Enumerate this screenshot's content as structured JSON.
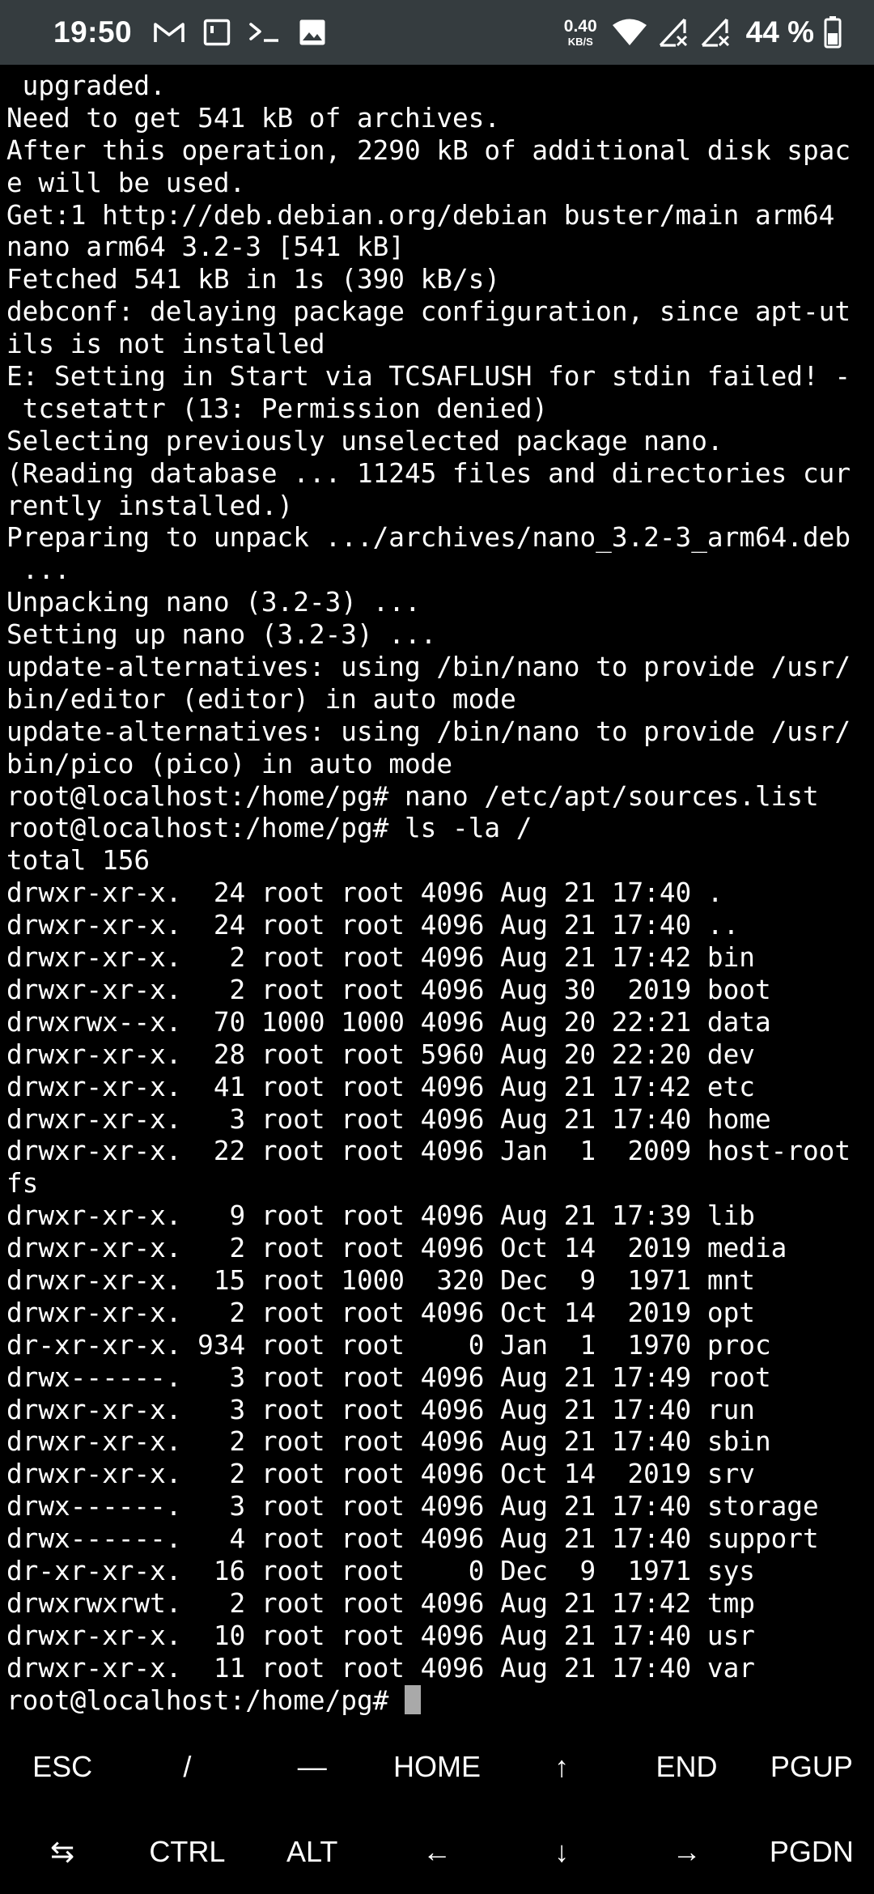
{
  "status_bar": {
    "time": "19:50",
    "notification_icons": [
      "gmail-icon",
      "notification-box-icon",
      "terminal-prompt-icon",
      "image-icon"
    ],
    "net_speed_value": "0.40",
    "net_speed_unit": "KB/S",
    "status_icons": [
      "wifi-icon",
      "signal-no-service-icon",
      "signal-no-service-icon-2",
      "battery-icon"
    ],
    "battery_percent": "44 %"
  },
  "terminal": {
    "lines": [
      " upgraded.",
      "Need to get 541 kB of archives.",
      "After this operation, 2290 kB of additional disk spac",
      "e will be used.",
      "Get:1 http://deb.debian.org/debian buster/main arm64",
      "nano arm64 3.2-3 [541 kB]",
      "Fetched 541 kB in 1s (390 kB/s)",
      "debconf: delaying package configuration, since apt-ut",
      "ils is not installed",
      "E: Setting in Start via TCSAFLUSH for stdin failed! -",
      " tcsetattr (13: Permission denied)",
      "Selecting previously unselected package nano.",
      "(Reading database ... 11245 files and directories cur",
      "rently installed.)",
      "Preparing to unpack .../archives/nano_3.2-3_arm64.deb",
      " ...",
      "Unpacking nano (3.2-3) ...",
      "Setting up nano (3.2-3) ...",
      "update-alternatives: using /bin/nano to provide /usr/",
      "bin/editor (editor) in auto mode",
      "update-alternatives: using /bin/nano to provide /usr/",
      "bin/pico (pico) in auto mode",
      "root@localhost:/home/pg# nano /etc/apt/sources.list",
      "root@localhost:/home/pg# ls -la /",
      "total 156",
      "drwxr-xr-x.  24 root root 4096 Aug 21 17:40 .",
      "drwxr-xr-x.  24 root root 4096 Aug 21 17:40 ..",
      "drwxr-xr-x.   2 root root 4096 Aug 21 17:42 bin",
      "drwxr-xr-x.   2 root root 4096 Aug 30  2019 boot",
      "drwxrwx--x.  70 1000 1000 4096 Aug 20 22:21 data",
      "drwxr-xr-x.  28 root root 5960 Aug 20 22:20 dev",
      "drwxr-xr-x.  41 root root 4096 Aug 21 17:42 etc",
      "drwxr-xr-x.   3 root root 4096 Aug 21 17:40 home",
      "drwxr-xr-x.  22 root root 4096 Jan  1  2009 host-root",
      "fs",
      "drwxr-xr-x.   9 root root 4096 Aug 21 17:39 lib",
      "drwxr-xr-x.   2 root root 4096 Oct 14  2019 media",
      "drwxr-xr-x.  15 root 1000  320 Dec  9  1971 mnt",
      "drwxr-xr-x.   2 root root 4096 Oct 14  2019 opt",
      "dr-xr-xr-x. 934 root root    0 Jan  1  1970 proc",
      "drwx------.   3 root root 4096 Aug 21 17:49 root",
      "drwxr-xr-x.   3 root root 4096 Aug 21 17:40 run",
      "drwxr-xr-x.   2 root root 4096 Aug 21 17:40 sbin",
      "drwxr-xr-x.   2 root root 4096 Oct 14  2019 srv",
      "drwx------.   3 root root 4096 Aug 21 17:40 storage",
      "drwx------.   4 root root 4096 Aug 21 17:40 support",
      "dr-xr-xr-x.  16 root root    0 Dec  9  1971 sys",
      "drwxrwxrwt.   2 root root 4096 Aug 21 17:42 tmp",
      "drwxr-xr-x.  10 root root 4096 Aug 21 17:40 usr",
      "drwxr-xr-x.  11 root root 4096 Aug 21 17:40 var"
    ],
    "prompt": "root@localhost:/home/pg# "
  },
  "extra_keys": {
    "row1": [
      "ESC",
      "/",
      "—",
      "HOME",
      "↑",
      "END",
      "PGUP"
    ],
    "row2": [
      "⇆",
      "CTRL",
      "ALT",
      "←",
      "↓",
      "→",
      "PGDN"
    ]
  },
  "colors": {
    "status_bar_bg": "#353c3f",
    "terminal_bg": "#000000",
    "terminal_fg": "#ffffff",
    "cursor": "#a9a9a9"
  }
}
